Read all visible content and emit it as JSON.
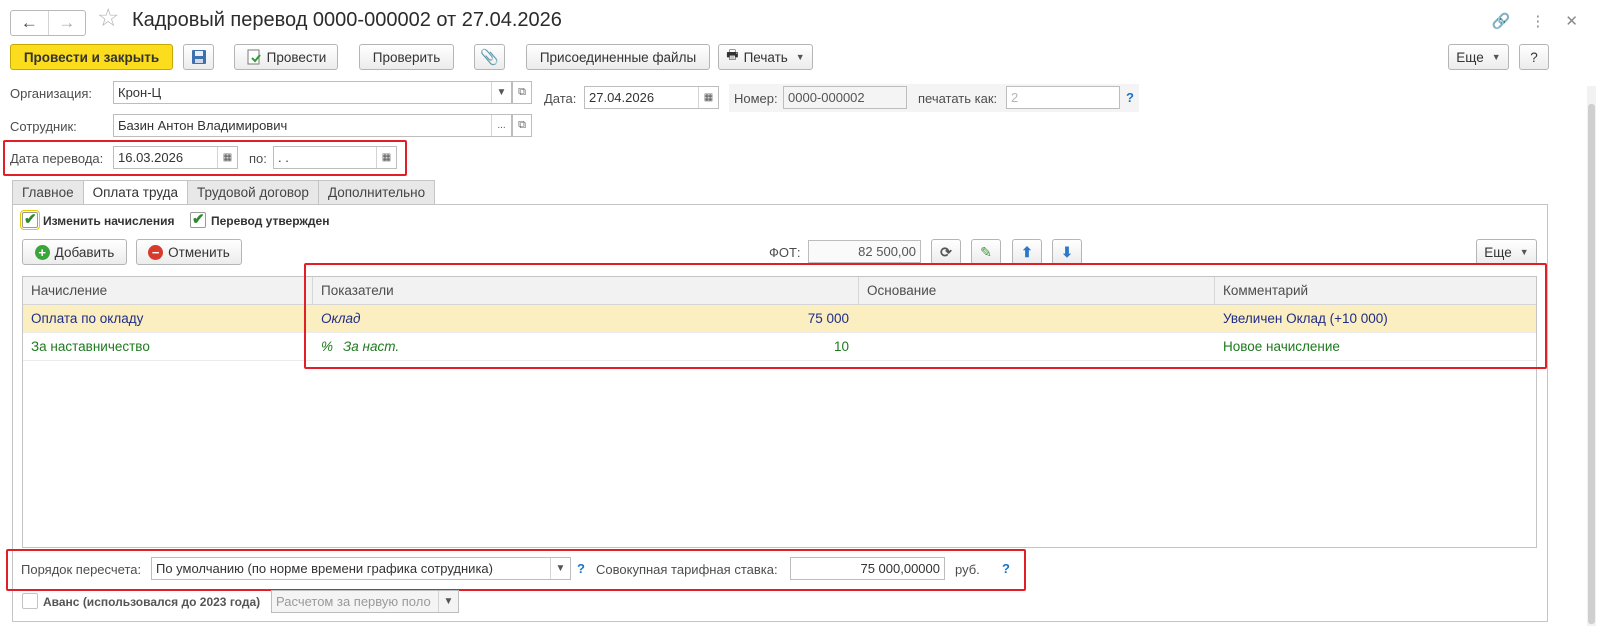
{
  "window": {
    "title": "Кадровый перевод 0000-000002 от 27.04.2026",
    "back_icon": "←",
    "forward_icon": "→"
  },
  "toolbar": {
    "post_and_close": "Провести и закрыть",
    "post": "Провести",
    "check": "Проверить",
    "attached_files": "Присоединенные файлы",
    "print": "Печать",
    "more": "Еще",
    "help": "?"
  },
  "header": {
    "organization_label": "Организация:",
    "organization_value": "Крон-Ц",
    "date_label": "Дата:",
    "date_value": "27.04.2026",
    "number_label": "Номер:",
    "number_value": "0000-000002",
    "print_as_label": "печатать как:",
    "print_as_placeholder": "2",
    "help": "?",
    "employee_label": "Сотрудник:",
    "employee_value": "Базин Антон Владимирович",
    "transfer_date_label": "Дата перевода:",
    "transfer_date_value": "16.03.2026",
    "to_label": "по:",
    "to_value": " .  ."
  },
  "tabs": [
    {
      "label": "Главное",
      "active": false
    },
    {
      "label": "Оплата труда",
      "active": true
    },
    {
      "label": "Трудовой договор",
      "active": false
    },
    {
      "label": "Дополнительно",
      "active": false
    }
  ],
  "pay": {
    "change_accruals_label": "Изменить начисления",
    "change_accruals_checked": true,
    "transfer_approved_label": "Перевод утвержден",
    "transfer_approved_checked": true,
    "add_label": "Добавить",
    "cancel_label": "Отменить",
    "fot_label": "ФОТ:",
    "fot_value": "82 500,00",
    "more_label": "Еще"
  },
  "grid": {
    "columns": [
      "Начисление",
      "Показатели",
      "Основание",
      "Комментарий"
    ],
    "rows": [
      {
        "accrual": "Оплата по окладу",
        "indicator_prefix": "",
        "indicator": "Оклад",
        "value": "75 000",
        "basis": "",
        "comment": "Увеличен Оклад (+10 000)",
        "selected": true,
        "color": "#1f2d8a"
      },
      {
        "accrual": "За наставничество",
        "indicator_prefix": "%",
        "indicator": "За наст.",
        "value": "10",
        "basis": "",
        "comment": "Новое начисление",
        "selected": false,
        "color": "#1e7a1e"
      }
    ]
  },
  "bottom": {
    "recalc_label": "Порядок пересчета:",
    "recalc_value": "По умолчанию (по норме времени графика сотрудника)",
    "help": "?",
    "total_rate_label": "Совокупная тарифная ставка:",
    "total_rate_value": "75 000,00000",
    "currency": "руб.",
    "help2": "?",
    "advance_label": "Аванс (использовался до 2023 года)",
    "advance_value": "Расчетом за первую поло"
  },
  "colors": {
    "accent": "#fbdd1e",
    "highlight_box": "#e11f26",
    "selected_row": "#fbeec0",
    "help_link": "#1a73c9"
  }
}
